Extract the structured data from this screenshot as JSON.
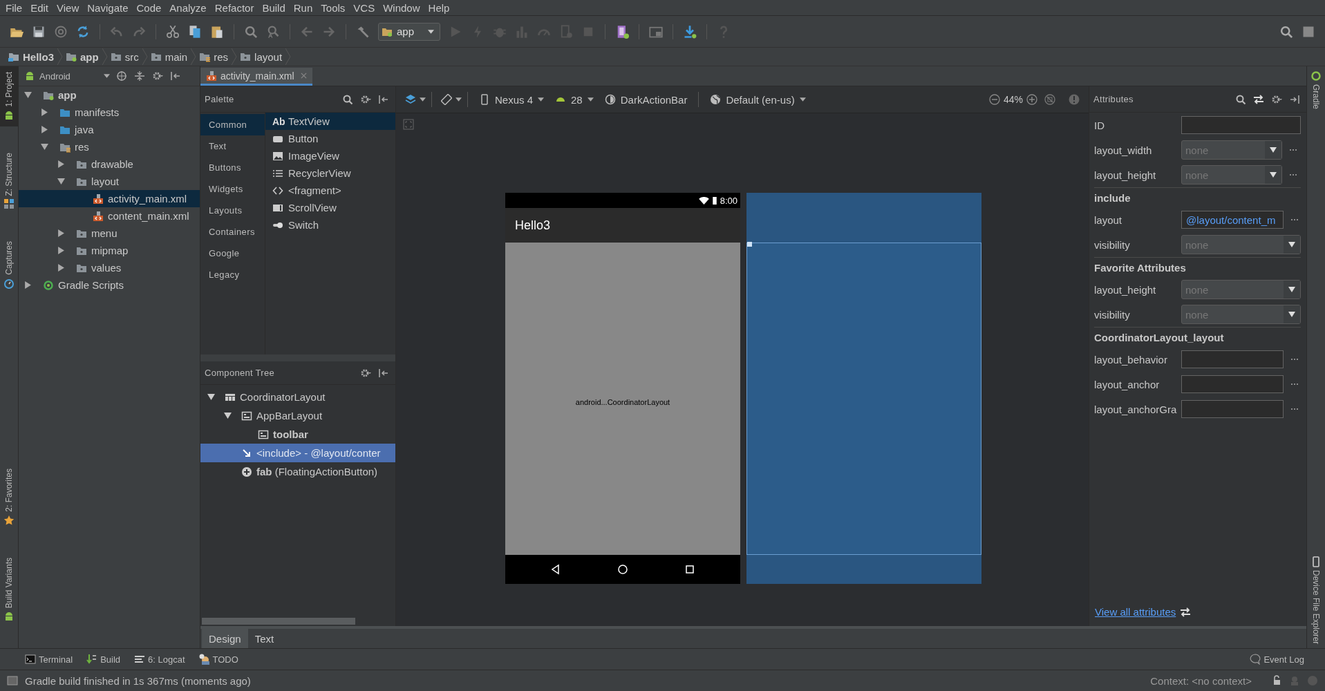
{
  "menu": [
    "File",
    "Edit",
    "View",
    "Navigate",
    "Code",
    "Analyze",
    "Refactor",
    "Build",
    "Run",
    "Tools",
    "VCS",
    "Window",
    "Help"
  ],
  "toolbar": {
    "run_config": "app"
  },
  "breadcrumb": [
    {
      "label": "Hello3",
      "bold": true,
      "kind": "project"
    },
    {
      "label": "app",
      "bold": true,
      "kind": "module"
    },
    {
      "label": "src",
      "bold": false,
      "kind": "folder"
    },
    {
      "label": "main",
      "bold": false,
      "kind": "folder"
    },
    {
      "label": "res",
      "bold": false,
      "kind": "res"
    },
    {
      "label": "layout",
      "bold": false,
      "kind": "folder"
    }
  ],
  "left_stripe": {
    "top": [
      {
        "label": "1: Project",
        "selected": true,
        "kind": "android"
      },
      {
        "label": "Z: Structure",
        "selected": false,
        "kind": "structure"
      },
      {
        "label": "Captures",
        "selected": false,
        "kind": "captures"
      }
    ],
    "bottom": [
      {
        "label": "2: Favorites",
        "selected": false,
        "kind": "star"
      },
      {
        "label": "Build Variants",
        "selected": false,
        "kind": "android"
      }
    ]
  },
  "project_panel": {
    "view": "Android",
    "tree": [
      {
        "label": "app",
        "kind": "module",
        "bold": true,
        "expanded": true,
        "selected": false,
        "children": [
          {
            "label": "manifests",
            "kind": "source-folder",
            "bold": false,
            "expanded": false,
            "selected": false
          },
          {
            "label": "java",
            "kind": "source-folder",
            "bold": false,
            "expanded": false,
            "selected": false
          },
          {
            "label": "res",
            "kind": "res-folder",
            "bold": false,
            "expanded": true,
            "selected": false,
            "children": [
              {
                "label": "drawable",
                "kind": "folder",
                "bold": false,
                "expanded": false,
                "selected": false
              },
              {
                "label": "layout",
                "kind": "folder",
                "bold": false,
                "expanded": true,
                "selected": false,
                "children": [
                  {
                    "label": "activity_main.xml",
                    "kind": "xml",
                    "bold": false,
                    "selected": true
                  },
                  {
                    "label": "content_main.xml",
                    "kind": "xml",
                    "bold": false,
                    "selected": false
                  }
                ]
              },
              {
                "label": "menu",
                "kind": "folder",
                "bold": false,
                "expanded": false,
                "selected": false
              },
              {
                "label": "mipmap",
                "kind": "folder",
                "bold": false,
                "expanded": false,
                "selected": false
              },
              {
                "label": "values",
                "kind": "folder",
                "bold": false,
                "expanded": false,
                "selected": false
              }
            ]
          }
        ]
      },
      {
        "label": "Gradle Scripts",
        "kind": "gradle",
        "bold": false,
        "expanded": false,
        "selected": false
      }
    ]
  },
  "editor_tabs": [
    {
      "label": "activity_main.xml",
      "selected": true
    }
  ],
  "palette": {
    "title": "Palette",
    "categories": [
      {
        "label": "Common",
        "selected": true
      },
      {
        "label": "Text",
        "selected": false
      },
      {
        "label": "Buttons",
        "selected": false
      },
      {
        "label": "Widgets",
        "selected": false
      },
      {
        "label": "Layouts",
        "selected": false
      },
      {
        "label": "Containers",
        "selected": false
      },
      {
        "label": "Google",
        "selected": false
      },
      {
        "label": "Legacy",
        "selected": false
      }
    ],
    "items": [
      {
        "label": "TextView",
        "kind": "text",
        "glyph": "Ab",
        "selected": true
      },
      {
        "label": "Button",
        "kind": "button",
        "selected": false
      },
      {
        "label": "ImageView",
        "kind": "image",
        "selected": false
      },
      {
        "label": "RecyclerView",
        "kind": "list",
        "selected": false
      },
      {
        "label": "<fragment>",
        "kind": "fragment",
        "selected": false
      },
      {
        "label": "ScrollView",
        "kind": "scroll",
        "selected": false
      },
      {
        "label": "Switch",
        "kind": "switch",
        "selected": false
      }
    ]
  },
  "component_tree": {
    "title": "Component Tree",
    "nodes": [
      {
        "label": "CoordinatorLayout",
        "kind": "coordinator",
        "expanded": true,
        "selected": false,
        "children": [
          {
            "label": "AppBarLayout",
            "kind": "appbar",
            "expanded": true,
            "selected": false,
            "children": [
              {
                "label": "**toolbar**",
                "kind": "toolbar",
                "selected": false
              }
            ]
          },
          {
            "label": "<include>  -  @layout/conter",
            "kind": "include",
            "selected": true
          },
          {
            "label": "**fab** (FloatingActionButton)",
            "kind": "fab",
            "selected": false
          }
        ]
      }
    ]
  },
  "design_toolbar": {
    "device": "Nexus 4",
    "api": "28",
    "theme": "DarkActionBar",
    "locale": "Default (en-us)",
    "zoom": "44%"
  },
  "preview": {
    "time": "8:00",
    "app_title": "Hello3",
    "content_label": "android...CoordinatorLayout"
  },
  "attributes": {
    "title": "Attributes",
    "rows": [
      {
        "kind": "text",
        "label": "ID",
        "more": false
      },
      {
        "kind": "dropdown",
        "label": "layout_width",
        "placeholder": "none",
        "more": true
      },
      {
        "kind": "dropdown",
        "label": "layout_height",
        "placeholder": "none",
        "more": true
      },
      {
        "kind": "section",
        "label": "include"
      },
      {
        "kind": "link",
        "label": "layout",
        "value": "@layout/content_m",
        "more": true
      },
      {
        "kind": "dropdown",
        "label": "visibility",
        "placeholder": "none",
        "more": false
      },
      {
        "kind": "section",
        "label": "Favorite Attributes"
      },
      {
        "kind": "dropdown",
        "label": "layout_height",
        "placeholder": "none",
        "more": false
      },
      {
        "kind": "dropdown",
        "label": "visibility",
        "placeholder": "none",
        "more": false
      },
      {
        "kind": "section",
        "label": "CoordinatorLayout_layout"
      },
      {
        "kind": "text",
        "label": "layout_behavior",
        "more": true
      },
      {
        "kind": "text",
        "label": "layout_anchor",
        "more": true
      },
      {
        "kind": "text",
        "label": "layout_anchorGra",
        "more": true
      }
    ],
    "link": "View all attributes"
  },
  "right_stripe": {
    "top": [
      {
        "label": "Gradle",
        "kind": "gradle"
      }
    ],
    "bottom": [
      {
        "label": "Device File Explorer",
        "kind": "device"
      }
    ]
  },
  "editor_mode_tabs": [
    {
      "label": "Design",
      "selected": true
    },
    {
      "label": "Text",
      "selected": false
    }
  ],
  "tool_windows": [
    {
      "label": "Terminal",
      "kind": "terminal"
    },
    {
      "label": "Build",
      "kind": "build"
    },
    {
      "label": "6: Logcat",
      "kind": "logcat"
    },
    {
      "label": "TODO",
      "kind": "todo"
    }
  ],
  "event_log": "Event Log",
  "status": {
    "message": "Gradle build finished in 1s 367ms (moments ago)",
    "context": "Context: <no context>"
  }
}
